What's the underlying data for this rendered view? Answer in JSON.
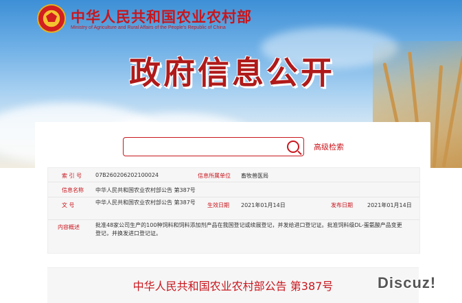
{
  "header": {
    "ministry_name_cn": "中华人民共和国农业农村部",
    "ministry_name_en": "Ministry of Agriculture and Rural Affairs of the People's Republic of China",
    "hero_title": "政府信息公开"
  },
  "search": {
    "placeholder": "",
    "advanced_label": "高级检索"
  },
  "info_table": {
    "index_label": "索 引 号",
    "index_value": "07B260206202100024",
    "dept_label": "信息所属单位",
    "dept_value": "畜牧兽医局",
    "name_label": "信息名称",
    "name_value": "中华人民共和国农业农村部公告 第387号",
    "docno_label": "文 号",
    "docno_value": "中华人民共和国农业农村部公告 第387号",
    "effective_label": "生效日期",
    "effective_value": "2021年01月14日",
    "publish_label": "发布日期",
    "publish_value": "2021年01月14日",
    "summary_label": "内容概述",
    "summary_value": "批准48家公司生产的100种饲料和饲料添加剂产品在我国登记或续展登记，并发给进口登记证。批准饲料级DL-蛋氨酸产品变更登记，并换发进口登记证。"
  },
  "document": {
    "title": "中华人民共和国农业农村部公告 第387号"
  },
  "watermark": "Discuz!",
  "colors": {
    "accent_red": "#c8161d",
    "sky_blue": "#6fb0e6",
    "panel_gray": "#f6f6f6"
  },
  "icons": [
    "national-emblem-icon",
    "search-icon"
  ]
}
